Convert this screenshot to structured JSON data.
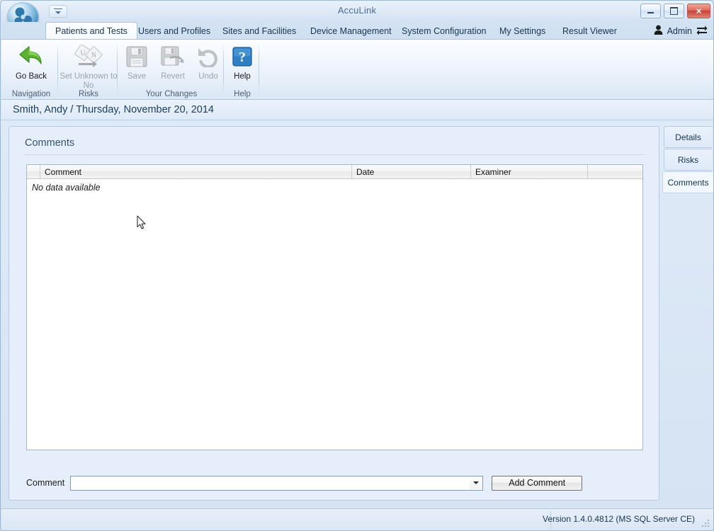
{
  "window": {
    "title": "AccuLink",
    "logo_icon": "acculink-logo-icon",
    "quick_access_icon": "customize-quick-access-toolbar-icon",
    "minimize_label": "Minimize",
    "maximize_label": "Maximize",
    "close_label": "×"
  },
  "tabs": [
    {
      "label": "Patients and Tests",
      "active": true
    },
    {
      "label": "Users and Profiles",
      "active": false
    },
    {
      "label": "Sites and Facilities",
      "active": false
    },
    {
      "label": "Device Management",
      "active": false
    },
    {
      "label": "System Configuration",
      "active": false
    },
    {
      "label": "My Settings",
      "active": false
    },
    {
      "label": "Result Viewer",
      "active": false
    }
  ],
  "account": {
    "user_label": "Admin",
    "user_icon": "user-avatar-icon",
    "switch_icon": "switch-user-icon"
  },
  "ribbon": {
    "groups": [
      {
        "name": "Navigation",
        "label": "Navigation",
        "items": [
          {
            "label": "Go Back",
            "icon": "go-back-arrow-icon",
            "enabled": true
          }
        ]
      },
      {
        "name": "Risks",
        "label": "Risks",
        "items": [
          {
            "label": "Set Unknown to No",
            "icon": "set-unknown-to-no-icon",
            "enabled": false
          }
        ]
      },
      {
        "name": "Your Changes",
        "label": "Your Changes",
        "items": [
          {
            "label": "Save",
            "icon": "save-floppy-icon",
            "enabled": false
          },
          {
            "label": "Revert",
            "icon": "revert-icon",
            "enabled": false
          },
          {
            "label": "Undo",
            "icon": "undo-arrow-icon",
            "enabled": false
          }
        ]
      },
      {
        "name": "Help",
        "label": "Help",
        "items": [
          {
            "label": "Help",
            "icon": "help-question-icon",
            "enabled": true
          }
        ]
      }
    ]
  },
  "patient_bar": {
    "text": "Smith, Andy / Thursday, November 20, 2014"
  },
  "panel": {
    "title": "Comments"
  },
  "grid": {
    "columns": [
      "Comment",
      "Date",
      "Examiner"
    ],
    "rows": [],
    "empty_message": "No data available"
  },
  "comment_entry": {
    "label": "Comment",
    "value": "",
    "placeholder": "",
    "dropdown_icon": "chevron-down-icon",
    "add_button_label": "Add Comment"
  },
  "sidebar": {
    "items": [
      {
        "label": "Details",
        "active": false
      },
      {
        "label": "Risks",
        "active": false
      },
      {
        "label": "Comments",
        "active": true
      }
    ]
  },
  "status_bar": {
    "version": "Version 1.4.0.4812 (MS SQL Server CE)",
    "grip_icon": "resize-grip-icon"
  },
  "colors": {
    "accent": "#2e6e9e",
    "title_text": "#4a6d99",
    "panel_bg": "#e6eefb",
    "close_button": "#c74436"
  }
}
